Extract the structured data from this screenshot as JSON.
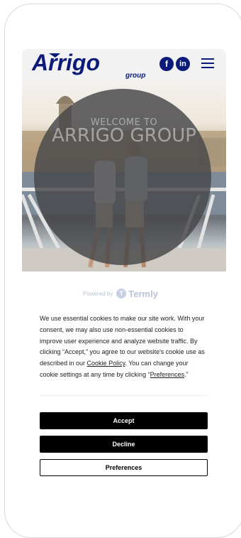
{
  "header": {
    "logo_word": "Arrigo",
    "logo_sub": "group",
    "facebook_glyph": "f",
    "linkedin_glyph": "in",
    "menu_icon": "hamburger-menu-icon",
    "brand_color": "#0c1a7a"
  },
  "hero": {
    "kicker": "WELCOME TO",
    "title": "ARRIGO GROUP",
    "image": "two-people-on-waterfront-railing"
  },
  "consent": {
    "powered_by": "Powered by",
    "provider": "Termly",
    "text_part1": "We use essential cookies to make our site work. With your consent, we may also use non-essential cookies to improve user experience and analyze website traffic. By clicking “Accept,” you agree to our website's cookie use as described in our ",
    "cookie_policy_link": "Cookie Policy",
    "text_part2": ". You can change your cookie settings at any time by clicking “",
    "preferences_link": "Preferences",
    "text_part3": ".”",
    "accept_label": "Accept",
    "decline_label": "Decline",
    "preferences_label": "Preferences"
  }
}
